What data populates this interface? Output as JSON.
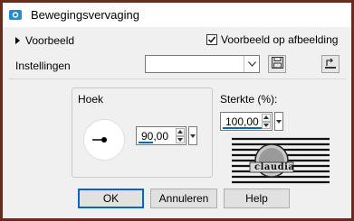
{
  "window": {
    "title": "Bewegingsvervaging"
  },
  "preview": {
    "toggle_label": "Voorbeeld",
    "checkbox_label": "Voorbeeld op afbeelding",
    "checkbox_checked": true
  },
  "settings": {
    "label": "Instellingen",
    "preset_value": ""
  },
  "angle": {
    "group_label": "Hoek",
    "value": "90,00"
  },
  "strength": {
    "label": "Sterkte (%):",
    "value": "100,00"
  },
  "watermark": {
    "text": "claudia"
  },
  "buttons": {
    "ok": "OK",
    "cancel": "Annuleren",
    "help": "Help"
  },
  "colors": {
    "accent": "#0a64c8",
    "frame": "#6b2a1c"
  }
}
